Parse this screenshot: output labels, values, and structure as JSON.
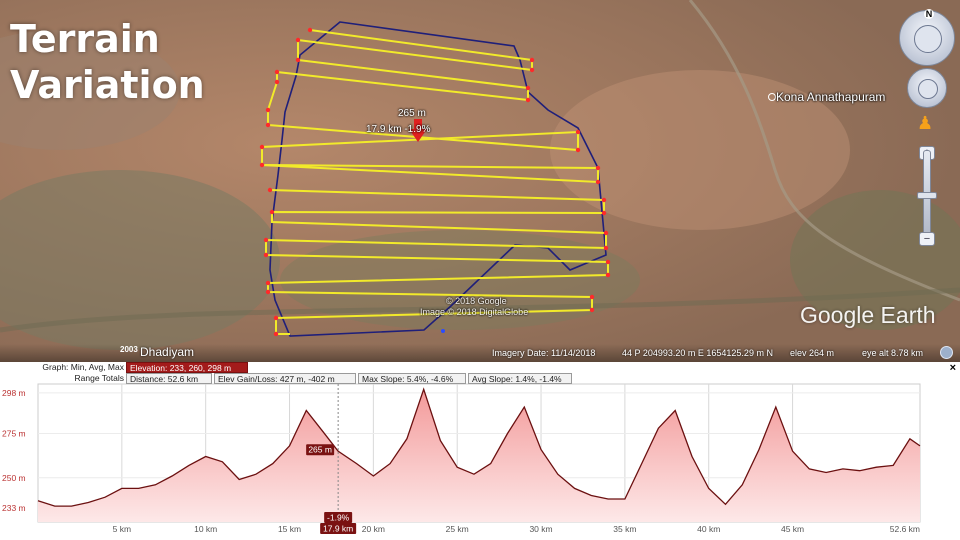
{
  "slide": {
    "title_line1": "Terrain",
    "title_line2": "Variation"
  },
  "map": {
    "annot_distance_elev": "265 m",
    "annot_dist_slope": "17.9 km   -1.9%",
    "copyright_line1": "© 2018 Google",
    "copyright_line2": "Image © 2018 DigitalGlobe",
    "town_label": "Kona Annathapuram",
    "logo_text": "Google Earth",
    "compass_letter": "N",
    "icons": {
      "compass": "compass-icon",
      "look": "look-joystick-icon",
      "move": "move-joystick-icon",
      "pegman": "pegman-icon",
      "zoom_in": "zoom-in-icon",
      "zoom_out": "zoom-out-icon"
    },
    "colors": {
      "survey_line": "#f2ea2a",
      "boundary": "#1f1f7a",
      "vertex": "#ff2a2a",
      "marker": "#e02020"
    }
  },
  "status": {
    "place": "Dhadiyam",
    "year_badge": "2003",
    "imagery_date": "Imagery Date: 11/14/2018",
    "coords": "44 P 204993.20 m E 1654125.29 m N",
    "elev": "elev   264 m",
    "eye_alt": "eye alt   8.78 km"
  },
  "profile": {
    "row1_label": "Graph: Min, Avg, Max",
    "elevation": "Elevation: 233, 260, 298 m",
    "row2_label": "Range Totals",
    "distance": "Distance: 52.6 km",
    "elev_gain_loss": "Elev Gain/Loss: 427 m, -402 m",
    "max_slope": "Max Slope: 5.4%, -4.6%",
    "avg_slope": "Avg Slope: 1.4%, -1.4%",
    "close": "×",
    "cursor_elev": "265 m",
    "cursor_slope": "-1.9%",
    "cursor_dist": "17.9 km",
    "colors": {
      "fill_top": "#f39a9a",
      "fill_bottom": "#fde8e8",
      "line": "#6b1010",
      "badge": "#7a1212"
    }
  },
  "chart_data": {
    "type": "area",
    "x_unit": "km",
    "y_unit": "m",
    "xlim": [
      0,
      52.6
    ],
    "ylim": [
      225,
      303
    ],
    "x_ticks": [
      "5 km",
      "10 km",
      "15 km",
      "20 km",
      "25 km",
      "30 km",
      "35 km",
      "40 km",
      "45 km"
    ],
    "x_tick_values": [
      5,
      10,
      15,
      20,
      25,
      30,
      35,
      40,
      45
    ],
    "x_end_label": "52.6 km",
    "y_ticks": [
      "298 m",
      "275 m",
      "250 m",
      "233 m"
    ],
    "y_tick_values": [
      298,
      275,
      250,
      233
    ],
    "grid": true,
    "series": [
      {
        "x": [
          0,
          1,
          2,
          3,
          4,
          5,
          6,
          7,
          8,
          9,
          10,
          11,
          12,
          13,
          14,
          15,
          16,
          17,
          17.9,
          19,
          20,
          21,
          22,
          23,
          24,
          25,
          26,
          27,
          28,
          29,
          30,
          31,
          32,
          33,
          34,
          35,
          36,
          37,
          38,
          39,
          40,
          41,
          42,
          43,
          44,
          45,
          46,
          47,
          48,
          49,
          50,
          51,
          52,
          52.6
        ],
        "y": [
          237,
          234,
          234,
          236,
          239,
          244,
          244,
          246,
          251,
          257,
          262,
          259,
          249,
          252,
          258,
          268,
          288,
          276,
          265,
          258,
          251,
          258,
          272,
          300,
          271,
          256,
          252,
          258,
          275,
          290,
          266,
          252,
          244,
          240,
          238,
          238,
          258,
          278,
          288,
          262,
          244,
          235,
          246,
          266,
          290,
          265,
          255,
          253,
          255,
          254,
          256,
          257,
          272,
          268
        ]
      }
    ],
    "cursor": {
      "x": 17.9,
      "y": 265,
      "slope": "-1.9%"
    }
  }
}
